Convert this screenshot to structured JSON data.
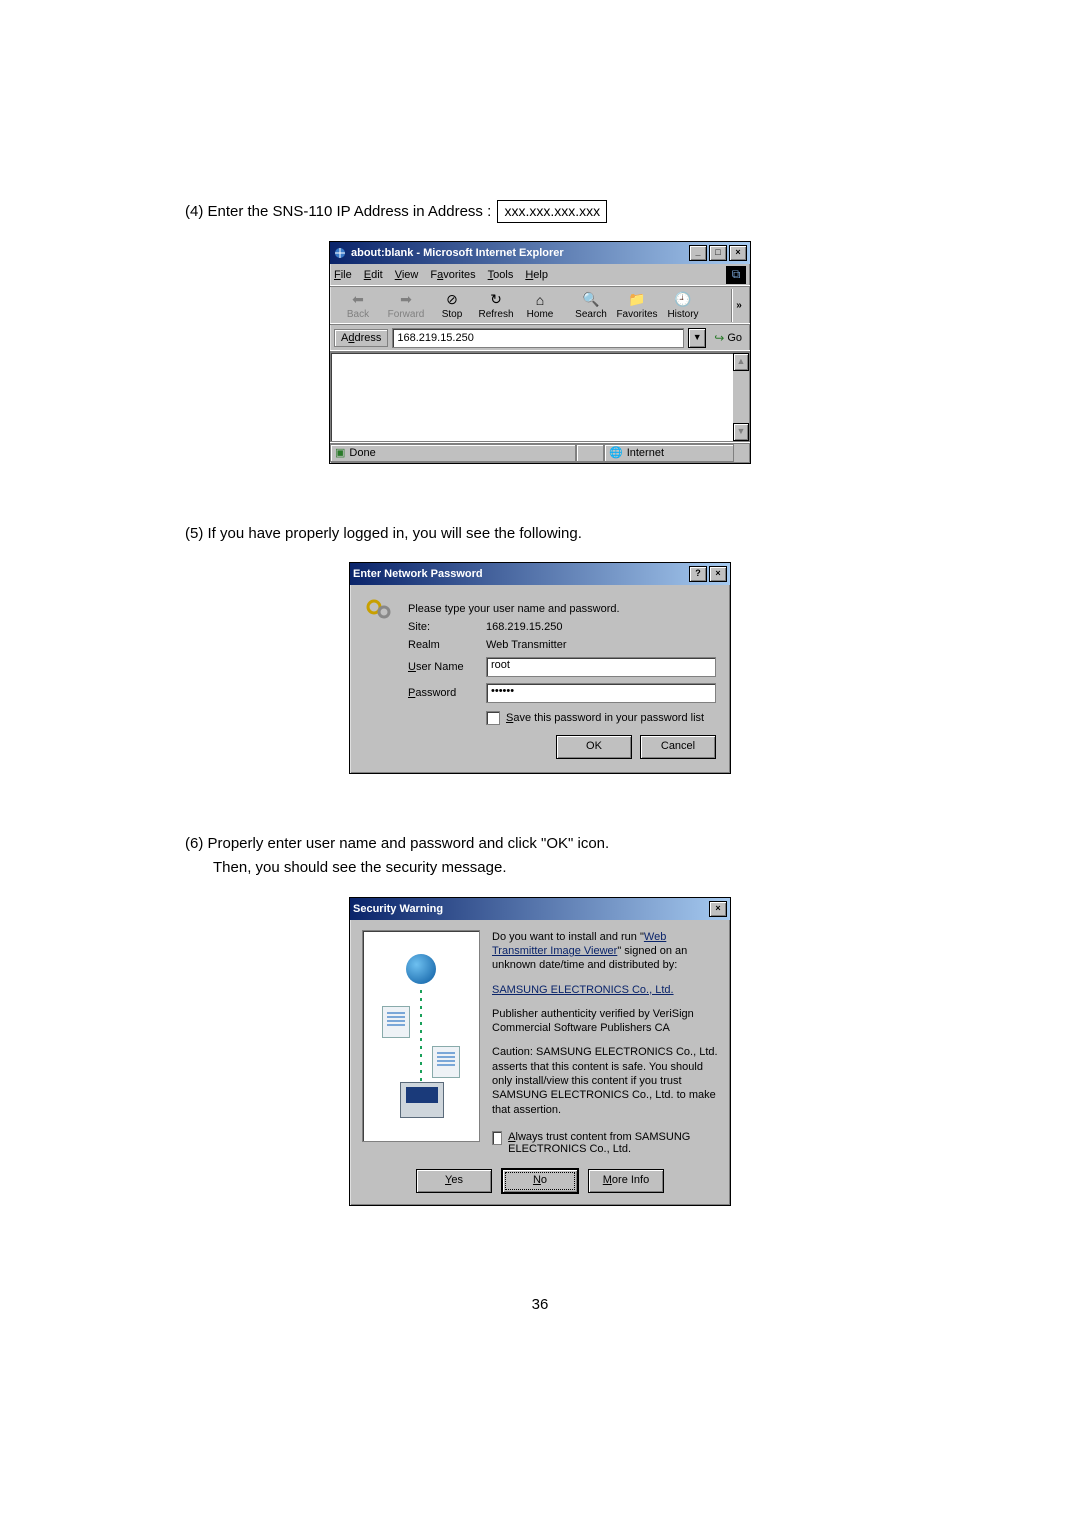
{
  "step4": {
    "text_prefix": "(4)  Enter the SNS-110 IP Address in Address : ",
    "ip_placeholder": "xxx.xxx.xxx.xxx"
  },
  "ie": {
    "title": "about:blank - Microsoft Internet Explorer",
    "menu": {
      "file": "File",
      "edit": "Edit",
      "view": "View",
      "favorites": "Favorites",
      "tools": "Tools",
      "help": "Help"
    },
    "toolbar": {
      "back": "Back",
      "forward": "Forward",
      "stop": "Stop",
      "refresh": "Refresh",
      "home": "Home",
      "search": "Search",
      "favorites": "Favorites",
      "history": "History",
      "overflow": "»"
    },
    "address_label": "Address",
    "address_value": "168.219.15.250",
    "go": "Go",
    "status_done": "Done",
    "status_zone": "Internet"
  },
  "step5": {
    "text": "(5)  If you have properly logged in, you will see the following."
  },
  "pw": {
    "title": "Enter Network Password",
    "prompt": "Please type your user name and password.",
    "site_label": "Site:",
    "site_value": "168.219.15.250",
    "realm_label": "Realm",
    "realm_value": "Web Transmitter",
    "user_label": "User Name",
    "user_value": "root",
    "pass_label": "Password",
    "pass_value": "••••••",
    "save_label": "Save this password in your password list",
    "ok": "OK",
    "cancel": "Cancel"
  },
  "step6a": {
    "text": "(6)  Properly enter user name and password and click \"OK\" icon."
  },
  "step6b": {
    "text": "Then, you should see the security message."
  },
  "sec": {
    "title": "Security Warning",
    "line1a": "Do you want to install and run \"",
    "link1": "Web Transmitter Image Viewer",
    "line1b": "\" signed on an unknown date/time and distributed by:",
    "link2": "SAMSUNG ELECTRONICS Co., Ltd.",
    "line3": "Publisher authenticity verified by VeriSign Commercial Software Publishers CA",
    "line4": "Caution: SAMSUNG ELECTRONICS Co., Ltd. asserts that this content is safe.  You should only install/view this content if you trust SAMSUNG ELECTRONICS Co., Ltd. to make that assertion.",
    "always": "Always trust content from SAMSUNG ELECTRONICS Co., Ltd.",
    "yes": "Yes",
    "no": "No",
    "more": "More Info"
  },
  "page_number": "36"
}
